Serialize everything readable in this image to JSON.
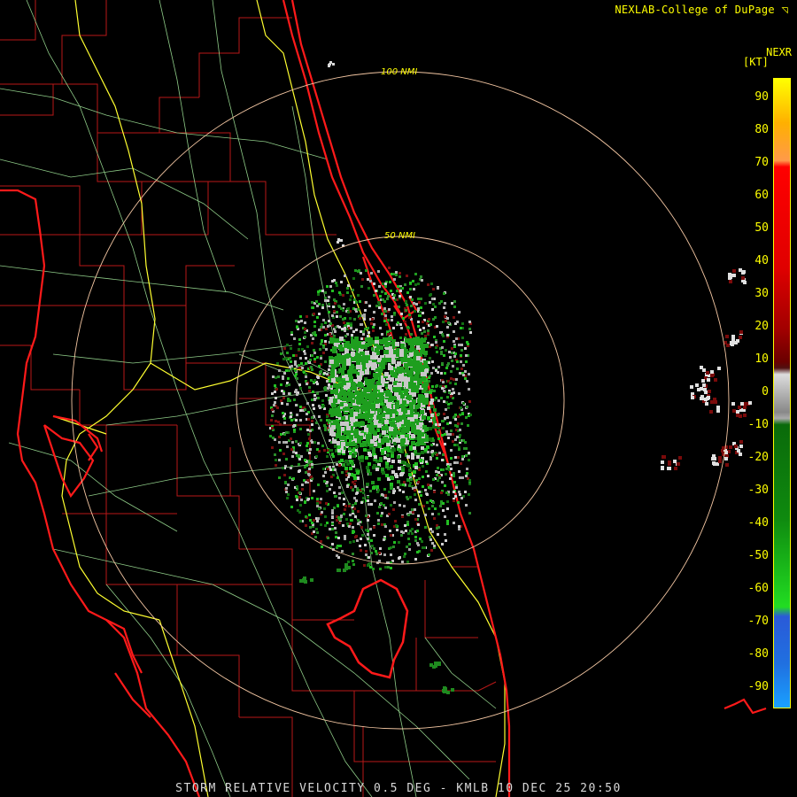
{
  "header": {
    "credit": "NEXLAB-College of DuPage"
  },
  "footer": {
    "product_line": "STORM RELATIVE VELOCITY 0.5 DEG - KMLB 10 DEC 25 20:50"
  },
  "map": {
    "radar_site": "KMLB",
    "range_rings": [
      "50 NMI",
      "100 NMI"
    ]
  },
  "colorbar": {
    "title": "NEXR",
    "unit": "[KT]",
    "ticks": [
      "90",
      "80",
      "70",
      "60",
      "50",
      "40",
      "30",
      "20",
      "10",
      "0",
      "-10",
      "-20",
      "-30",
      "-40",
      "-50",
      "-60",
      "-70",
      "-80",
      "-90"
    ],
    "colors": {
      "top": "#ffff00",
      "orange": "#ff9a4a",
      "red": "#ff0000",
      "dark_red": "#6a0000",
      "gray": "#888888",
      "dark_green": "#0a6a0a",
      "green": "#22dd22",
      "blue": "#2a5ad8",
      "light_blue": "#1aa0ff"
    }
  },
  "colors": {
    "coastline": "#ff2020",
    "county_lines": "#c01818",
    "roads": "#b8ffb0",
    "interstates": "#ffff40",
    "rings": "#f0c8a0"
  }
}
